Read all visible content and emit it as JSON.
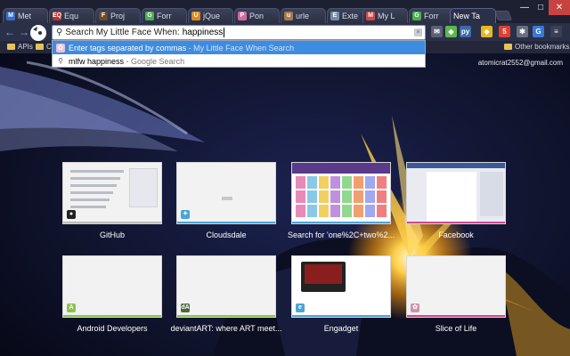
{
  "tabs": [
    {
      "label": "Met",
      "favicon": "M",
      "favicon_color": "#3a6cc8"
    },
    {
      "label": "Equ",
      "favicon": "EQ",
      "favicon_color": "#c03030"
    },
    {
      "label": "Proj",
      "favicon": "F",
      "favicon_color": "#6a4b28"
    },
    {
      "label": "Forr",
      "favicon": "G",
      "favicon_color": "#4caf50"
    },
    {
      "label": "jQue",
      "favicon": "U",
      "favicon_color": "#e08a1e"
    },
    {
      "label": "Pon",
      "favicon": "P",
      "favicon_color": "#d36aa0"
    },
    {
      "label": "urle",
      "favicon": "u",
      "favicon_color": "#a47b52"
    },
    {
      "label": "Exte",
      "favicon": "E",
      "favicon_color": "#7a8aa8"
    },
    {
      "label": "My L",
      "favicon": "M",
      "favicon_color": "#d04848"
    },
    {
      "label": "Forr",
      "favicon": "G",
      "favicon_color": "#4caf50"
    },
    {
      "label": "New Ta",
      "favicon": "",
      "favicon_color": "#2b3049",
      "active": true
    }
  ],
  "window_controls": {
    "minimize": "—",
    "maximize": "□",
    "close": "✕"
  },
  "toolbar": {
    "back_icon": "arrow-left-icon",
    "back_glyph": "←",
    "forward_glyph": "→",
    "reload_glyph": "⟳"
  },
  "omnibox": {
    "keyword_label": "Search My Little Face When:",
    "value": "happiness",
    "close_glyph": "×"
  },
  "dropdown": {
    "rows": [
      {
        "main": "Enter tags separated by commas",
        "sep": " - ",
        "source": "My Little Face When Search"
      },
      {
        "main": "mlfw happiness",
        "sep": " - ",
        "source": "Google Search"
      }
    ]
  },
  "extensions": [
    {
      "name": "mail-icon",
      "glyph": "✉",
      "color": "#5b6074"
    },
    {
      "name": "puzzle-icon",
      "glyph": "◆",
      "color": "#5cb84a"
    },
    {
      "name": "python-icon",
      "glyph": "py",
      "color": "#3a6aa8"
    },
    {
      "name": "shield-icon",
      "glyph": "◈",
      "color": "#e8b81a"
    },
    {
      "name": "badge-icon",
      "glyph": "5",
      "color": "#e04030"
    },
    {
      "name": "gear-icon",
      "glyph": "✱",
      "color": "#6a6f84"
    },
    {
      "name": "translate-icon",
      "glyph": "G",
      "color": "#3a78d8"
    },
    {
      "name": "menu-icon",
      "glyph": "≡",
      "color": "#3a3f58"
    }
  ],
  "bookmarks": {
    "items": [
      {
        "label": "APIs"
      },
      {
        "label": "C"
      }
    ],
    "other_label": "Other bookmarks"
  },
  "account": {
    "email": "atomicrat2552@gmail.com"
  },
  "thumbnails": [
    {
      "title": "GitHub",
      "bar_color": "#bdbdbd",
      "fav": "●",
      "fav_color": "#222"
    },
    {
      "title": "Cloudsdale",
      "bar_color": "#4aa3d8",
      "fav": "✦",
      "fav_color": "#4aa3d8"
    },
    {
      "title": "Search for 'one%2C+two%2...",
      "bar_color": "#4aa3d8",
      "fav": "",
      "fav_color": "#d04848"
    },
    {
      "title": "Facebook",
      "bar_color": "#d04890",
      "fav": "",
      "fav_color": "#3b5998"
    },
    {
      "title": "Android Developers",
      "bar_color": "#8bc34a",
      "fav": "A",
      "fav_color": "#8bc34a"
    },
    {
      "title": "deviantART: where ART meet...",
      "bar_color": "#8bc34a",
      "fav": "dA",
      "fav_color": "#4a6a3a"
    },
    {
      "title": "Engadget",
      "bar_color": "#4aa3d8",
      "fav": "e",
      "fav_color": "#4aa3d8"
    },
    {
      "title": "Slice of Life",
      "bar_color": "#d04890",
      "fav": "✿",
      "fav_color": "#d090a8"
    }
  ]
}
